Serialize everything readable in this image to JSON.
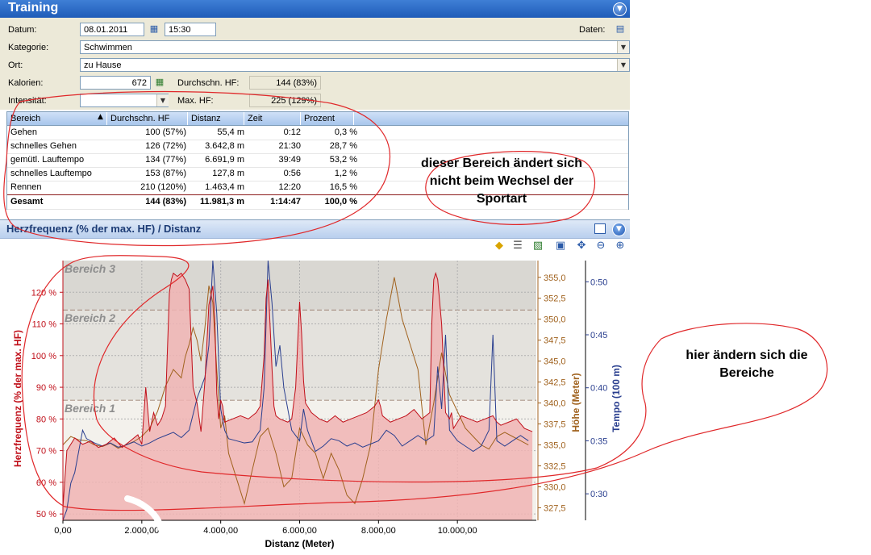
{
  "window": {
    "title": "Training"
  },
  "form": {
    "datum_label": "Datum:",
    "datum_value": "08.01.2011",
    "time_value": "15:30",
    "daten_label": "Daten:",
    "kategorie_label": "Kategorie:",
    "kategorie_value": "Schwimmen",
    "ort_label": "Ort:",
    "ort_value": "zu Hause",
    "kalorien_label": "Kalorien:",
    "kalorien_value": "672",
    "avg_hf_label": "Durchschn. HF:",
    "avg_hf_value": "144 (83%)",
    "intensitaet_label": "Intensität:",
    "intensitaet_value": "",
    "max_hf_label": "Max. HF:",
    "max_hf_value": "225 (129%)"
  },
  "table": {
    "headers": [
      "Bereich",
      "Durchschn. HF",
      "Distanz",
      "Zeit",
      "Prozent"
    ],
    "rows": [
      [
        "Gehen",
        "100 (57%)",
        "55,4 m",
        "0:12",
        "0,3 %"
      ],
      [
        "schnelles Gehen",
        "126 (72%)",
        "3.642,8 m",
        "21:30",
        "28,7 %"
      ],
      [
        "gemütl. Lauftempo",
        "134 (77%)",
        "6.691,9 m",
        "39:49",
        "53,2 %"
      ],
      [
        "schnelles Lauftempo",
        "153 (87%)",
        "127,8 m",
        "0:56",
        "1,2 %"
      ],
      [
        "Rennen",
        "210 (120%)",
        "1.463,4 m",
        "12:20",
        "16,5 %"
      ]
    ],
    "total": [
      "Gesamt",
      "144 (83%)",
      "11.981,3 m",
      "1:14:47",
      "100,0 %"
    ]
  },
  "chart_panel": {
    "title": "Herzfrequenz (% der max. HF)  / Distanz",
    "icons": [
      "diamond-icon",
      "table-icon",
      "chart-icon",
      "save-icon",
      "settings-icon",
      "zoom-out-icon",
      "zoom-in-icon"
    ]
  },
  "annotations": {
    "note1": "dieser Bereich ändert sich nicht beim Wechsel der Sportart",
    "note2": "hier ändern sich die Bereiche"
  },
  "colors": {
    "hr": "#c0101a",
    "hr_fill": "#f0b4b4",
    "elevation": "#a0621e",
    "pace": "#2a3f8f",
    "annotation": "#e0282a"
  },
  "chart_data": {
    "type": "line",
    "xlabel": "Distanz (Meter)",
    "ylabel_left": "Herzfrequenz (% der max. HF)",
    "ylabel_right1": "Höhe (Meter)",
    "ylabel_right2": "Tempo (100 m)",
    "xlim": [
      0,
      12000
    ],
    "ylim_left": [
      48,
      130
    ],
    "ylim_right1": [
      326,
      357
    ],
    "ylim_right2": [
      0.275,
      0.52
    ],
    "x_ticks": [
      "0,00",
      "2.000,00",
      "4.000,00",
      "6.000,00",
      "8.000,00",
      "10.000,00"
    ],
    "y_ticks_left": [
      "50 %",
      "60 %",
      "70 %",
      "80 %",
      "90 %",
      "100 %",
      "110 %",
      "120 %"
    ],
    "y_ticks_right1": [
      "327,5",
      "330,0",
      "332,5",
      "335,0",
      "337,5",
      "340,0",
      "342,5",
      "345,0",
      "347,5",
      "350,0",
      "352,5",
      "355,0"
    ],
    "y_ticks_right2": [
      "0:30",
      "0:35",
      "0:40",
      "0:45",
      "0:50"
    ],
    "zones": [
      {
        "name": "Bereich 1",
        "from": 48,
        "to": 86
      },
      {
        "name": "Bereich 2",
        "from": 86,
        "to": 114.5
      },
      {
        "name": "Bereich 3",
        "from": 114.5,
        "to": 130
      }
    ],
    "series": [
      {
        "name": "Herzfrequenz",
        "axis": "left",
        "x": [
          0,
          100,
          200,
          300,
          500,
          700,
          900,
          1100,
          1300,
          1500,
          1700,
          1900,
          2000,
          2100,
          2200,
          2300,
          2400,
          2500,
          2600,
          2700,
          2750,
          2800,
          2900,
          3000,
          3100,
          3200,
          3300,
          3400,
          3500,
          3600,
          3700,
          3800,
          3850,
          3900,
          3950,
          4000,
          4050,
          4100,
          4300,
          4500,
          4700,
          4900,
          5000,
          5100,
          5150,
          5200,
          5250,
          5300,
          5350,
          5400,
          5500,
          5700,
          5800,
          5900,
          6000,
          6050,
          6100,
          6150,
          6200,
          6300,
          6500,
          6700,
          6900,
          7100,
          7300,
          7500,
          7700,
          7900,
          8000,
          8050,
          8100,
          8200,
          8300,
          8500,
          8700,
          8900,
          9100,
          9300,
          9350,
          9400,
          9450,
          9500,
          9600,
          9700,
          9800,
          9850,
          9900,
          10000,
          10100,
          10300,
          10500,
          10700,
          10900,
          11000,
          11100,
          11300,
          11500,
          11700,
          11900
        ],
        "values": [
          52,
          70,
          72,
          74,
          72,
          73,
          71,
          72,
          74,
          71,
          73,
          75,
          72,
          90,
          76,
          82,
          78,
          80,
          84,
          120,
          124,
          126,
          125,
          126,
          124,
          121,
          90,
          85,
          76,
          92,
          116,
          122,
          112,
          88,
          80,
          86,
          84,
          79,
          80,
          81,
          80,
          82,
          84,
          100,
          118,
          124,
          110,
          96,
          84,
          81,
          80,
          79,
          80,
          90,
          117,
          107,
          92,
          85,
          84,
          82,
          80,
          79,
          81,
          79,
          80,
          81,
          82,
          84,
          86,
          84,
          81,
          80,
          79,
          80,
          81,
          83,
          80,
          82,
          110,
          124,
          126,
          124,
          110,
          82,
          80,
          82,
          77,
          79,
          81,
          80,
          79,
          80,
          81,
          79,
          78,
          79,
          80,
          77,
          76
        ]
      },
      {
        "name": "Höhe",
        "axis": "right1",
        "x": [
          0,
          200,
          400,
          600,
          800,
          1000,
          1200,
          1400,
          1600,
          1800,
          2000,
          2200,
          2400,
          2600,
          2800,
          3000,
          3100,
          3200,
          3300,
          3400,
          3500,
          3600,
          3700,
          3800,
          3900,
          4000,
          4100,
          4200,
          4400,
          4600,
          4800,
          5000,
          5200,
          5400,
          5600,
          5800,
          6000,
          6200,
          6400,
          6600,
          6800,
          7000,
          7200,
          7400,
          7600,
          7800,
          8000,
          8200,
          8400,
          8600,
          8800,
          9000,
          9200,
          9400,
          9600,
          9800,
          10000,
          10200,
          10400,
          10600,
          10800,
          11000,
          11200,
          11400,
          11600,
          11800
        ],
        "values": [
          335.0,
          336.0,
          335.6,
          335.5,
          335.0,
          334.8,
          335.2,
          334.6,
          335.0,
          335.4,
          336.0,
          337.0,
          339.0,
          342.0,
          344.0,
          343.0,
          345.5,
          347.0,
          349.0,
          347.5,
          345.0,
          349.0,
          354.0,
          352.0,
          344.0,
          337.0,
          338.5,
          334.0,
          331.0,
          328.0,
          332.0,
          336.0,
          337.0,
          334.0,
          330.0,
          331.0,
          337.0,
          335.0,
          334.0,
          331.0,
          334.0,
          332.0,
          329.0,
          328.0,
          331.0,
          335.0,
          344.0,
          350.0,
          355.0,
          350.0,
          347.0,
          344.0,
          335.0,
          340.0,
          346.0,
          341.0,
          339.0,
          337.0,
          336.0,
          335.0,
          334.5,
          336.0,
          336.5,
          336.0,
          335.5,
          335.0
        ]
      },
      {
        "name": "Tempo",
        "axis": "right2",
        "x": [
          0,
          100,
          200,
          300,
          400,
          500,
          600,
          800,
          1000,
          1200,
          1400,
          1600,
          1800,
          2000,
          2200,
          2400,
          2600,
          2800,
          3000,
          3200,
          3400,
          3600,
          3700,
          3800,
          3900,
          4000,
          4100,
          4200,
          4400,
          4600,
          4800,
          5000,
          5100,
          5200,
          5300,
          5400,
          5500,
          5600,
          5800,
          6000,
          6100,
          6200,
          6300,
          6400,
          6600,
          6800,
          7000,
          7200,
          7400,
          7600,
          7800,
          8000,
          8200,
          8400,
          8600,
          8800,
          9000,
          9200,
          9400,
          9500,
          9600,
          9700,
          9800,
          10000,
          10200,
          10400,
          10600,
          10800,
          10900,
          11000,
          11200,
          11400,
          11600,
          11800
        ],
        "values": [
          0.275,
          0.285,
          0.31,
          0.32,
          0.34,
          0.36,
          0.352,
          0.348,
          0.345,
          0.348,
          0.344,
          0.346,
          0.349,
          0.345,
          0.348,
          0.352,
          0.355,
          0.358,
          0.353,
          0.36,
          0.39,
          0.41,
          0.44,
          0.52,
          0.47,
          0.38,
          0.36,
          0.352,
          0.35,
          0.348,
          0.349,
          0.36,
          0.4,
          0.52,
          0.48,
          0.42,
          0.44,
          0.4,
          0.36,
          0.35,
          0.38,
          0.36,
          0.35,
          0.34,
          0.345,
          0.352,
          0.35,
          0.345,
          0.348,
          0.344,
          0.347,
          0.35,
          0.36,
          0.355,
          0.345,
          0.35,
          0.355,
          0.35,
          0.355,
          0.42,
          0.38,
          0.45,
          0.36,
          0.35,
          0.345,
          0.34,
          0.345,
          0.36,
          0.45,
          0.35,
          0.345,
          0.35,
          0.355,
          0.35
        ]
      }
    ]
  }
}
